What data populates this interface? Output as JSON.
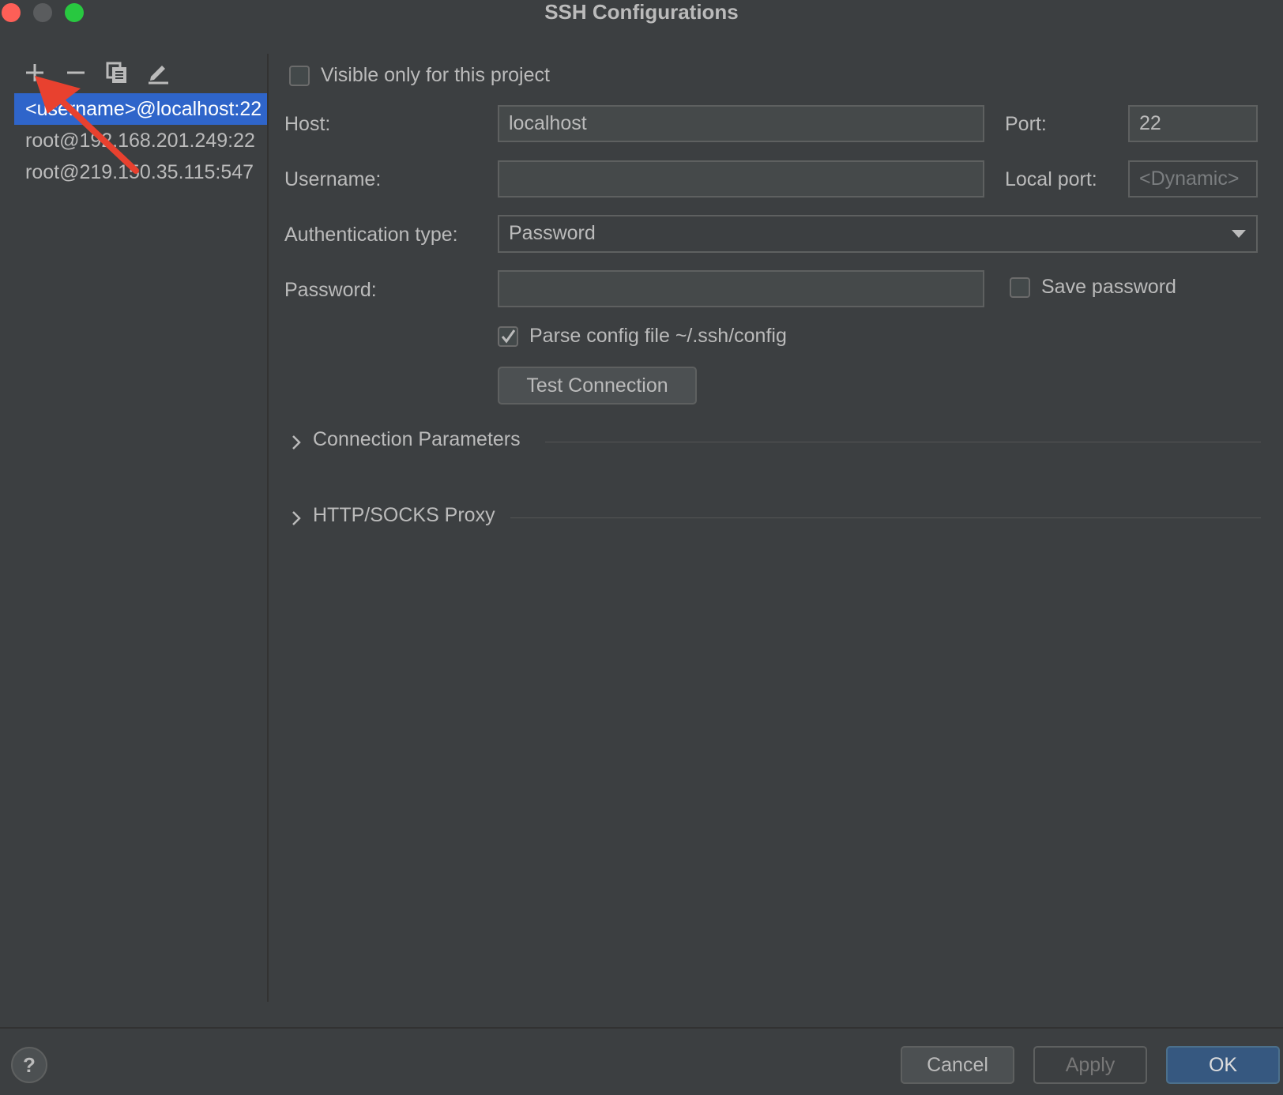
{
  "window": {
    "title": "SSH Configurations"
  },
  "toolbar": {
    "add": "add-icon",
    "remove": "remove-icon",
    "copy": "copy-icon",
    "edit": "edit-icon"
  },
  "configs": [
    {
      "label": "<username>@localhost:22",
      "selected": true
    },
    {
      "label": "root@192.168.201.249:22",
      "selected": false
    },
    {
      "label": "root@219.150.35.115:547",
      "selected": false
    }
  ],
  "form": {
    "visible_only_label": "Visible only for this project",
    "visible_only_checked": false,
    "host_label": "Host:",
    "host_value": "localhost",
    "port_label": "Port:",
    "port_value": "22",
    "username_label": "Username:",
    "username_value": "",
    "local_port_label": "Local port:",
    "local_port_placeholder": "<Dynamic>",
    "auth_type_label": "Authentication type:",
    "auth_type_value": "Password",
    "password_label": "Password:",
    "password_value": "",
    "save_password_label": "Save password",
    "save_password_checked": false,
    "parse_config_label": "Parse config file ~/.ssh/config",
    "parse_config_checked": true,
    "test_connection_label": "Test Connection"
  },
  "sections": {
    "connection_parameters": "Connection Parameters",
    "proxy": "HTTP/SOCKS Proxy"
  },
  "footer": {
    "help": "?",
    "cancel": "Cancel",
    "apply": "Apply",
    "ok": "OK"
  },
  "colors": {
    "background": "#3c3f41",
    "selection": "#2f65ca",
    "ok_button": "#365880",
    "annotation_arrow": "#e8412f"
  }
}
